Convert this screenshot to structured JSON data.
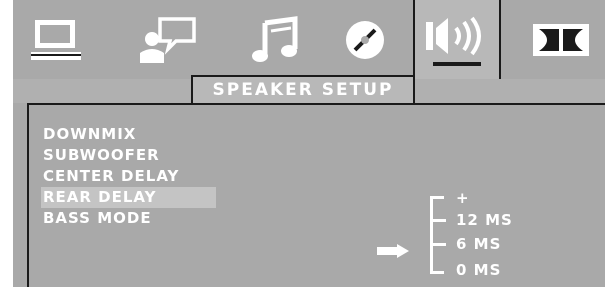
{
  "tabs": [
    {
      "icon": "monitor-icon",
      "active": false
    },
    {
      "icon": "language-speech-icon",
      "active": false
    },
    {
      "icon": "music-note-icon",
      "active": false
    },
    {
      "icon": "disc-icon",
      "active": false
    },
    {
      "icon": "speaker-icon",
      "active": true
    },
    {
      "icon": "dolby-icon",
      "active": false
    }
  ],
  "header": {
    "title": "SPEAKER SETUP"
  },
  "menu": {
    "items": [
      {
        "label": "DOWNMIX"
      },
      {
        "label": "SUBWOOFER"
      },
      {
        "label": "CENTER DELAY"
      },
      {
        "label": "REAR DELAY",
        "selected": true
      },
      {
        "label": "BASS MODE"
      }
    ]
  },
  "options": {
    "items": [
      {
        "label": "+",
        "dash": false
      },
      {
        "label": "12 MS",
        "dash": true
      },
      {
        "label": "6 MS",
        "dash": true,
        "selected": true
      },
      {
        "label": "0 MS",
        "dash": false
      }
    ],
    "pointer_icon": "arrow-pointer-icon"
  },
  "colors": {
    "background": "#a9a9a9",
    "text": "#ffffff",
    "outline": "#1a1a1a",
    "highlight": "#c4c4c4"
  }
}
